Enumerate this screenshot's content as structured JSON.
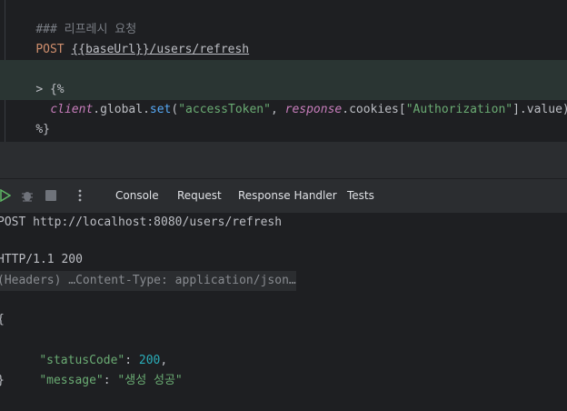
{
  "editor": {
    "comment": "### 리프레시 요청",
    "method": "POST",
    "url_var": "{{baseUrl}}",
    "url_path": "/users/refresh",
    "script_open": "> {%",
    "script_obj": "client",
    "script_global": ".global.",
    "script_fn": "set",
    "script_arg1": "\"accessToken\"",
    "script_resp": "response",
    "script_cookies": ".cookies",
    "script_key": "\"Authorization\"",
    "script_value": "].value);",
    "script_close": "%}"
  },
  "toolbar": {
    "tabs": [
      "Console",
      "Request",
      "Response Handler",
      "Tests"
    ],
    "active_tab": "Console"
  },
  "console": {
    "request_line": "POST http://localhost:8080/users/refresh",
    "status_line": "HTTP/1.1 200",
    "headers_line": "(Headers) …Content-Type: application/json…",
    "open_brace": "{",
    "status_key": "\"statusCode\"",
    "status_value": "200",
    "message_key": "\"message\"",
    "message_value": "\"생성 성공\"",
    "close_brace": "}"
  }
}
